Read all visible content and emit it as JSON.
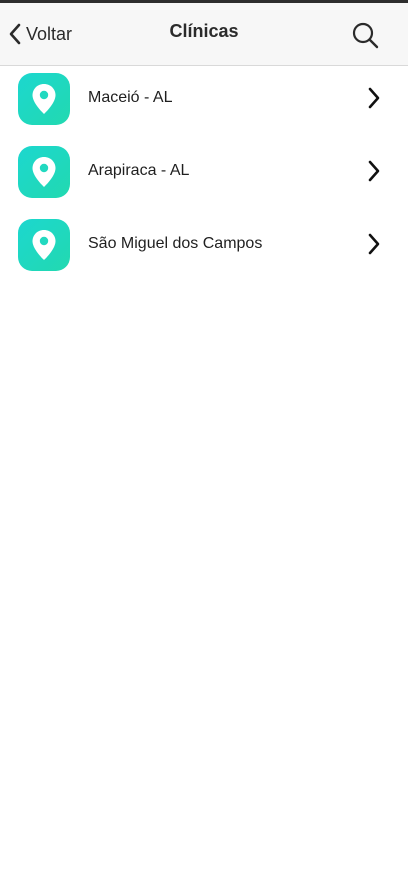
{
  "navbar": {
    "back_label": "Voltar",
    "title": "Clínicas",
    "back_icon": "chevron-left-icon",
    "search_icon": "search-icon"
  },
  "clinics": {
    "icon": "map-pin-icon",
    "accent_color": "#1cd7cf",
    "items": [
      {
        "label": "Maceió - AL"
      },
      {
        "label": "Arapiraca - AL"
      },
      {
        "label": "São Miguel dos Campos"
      }
    ]
  }
}
